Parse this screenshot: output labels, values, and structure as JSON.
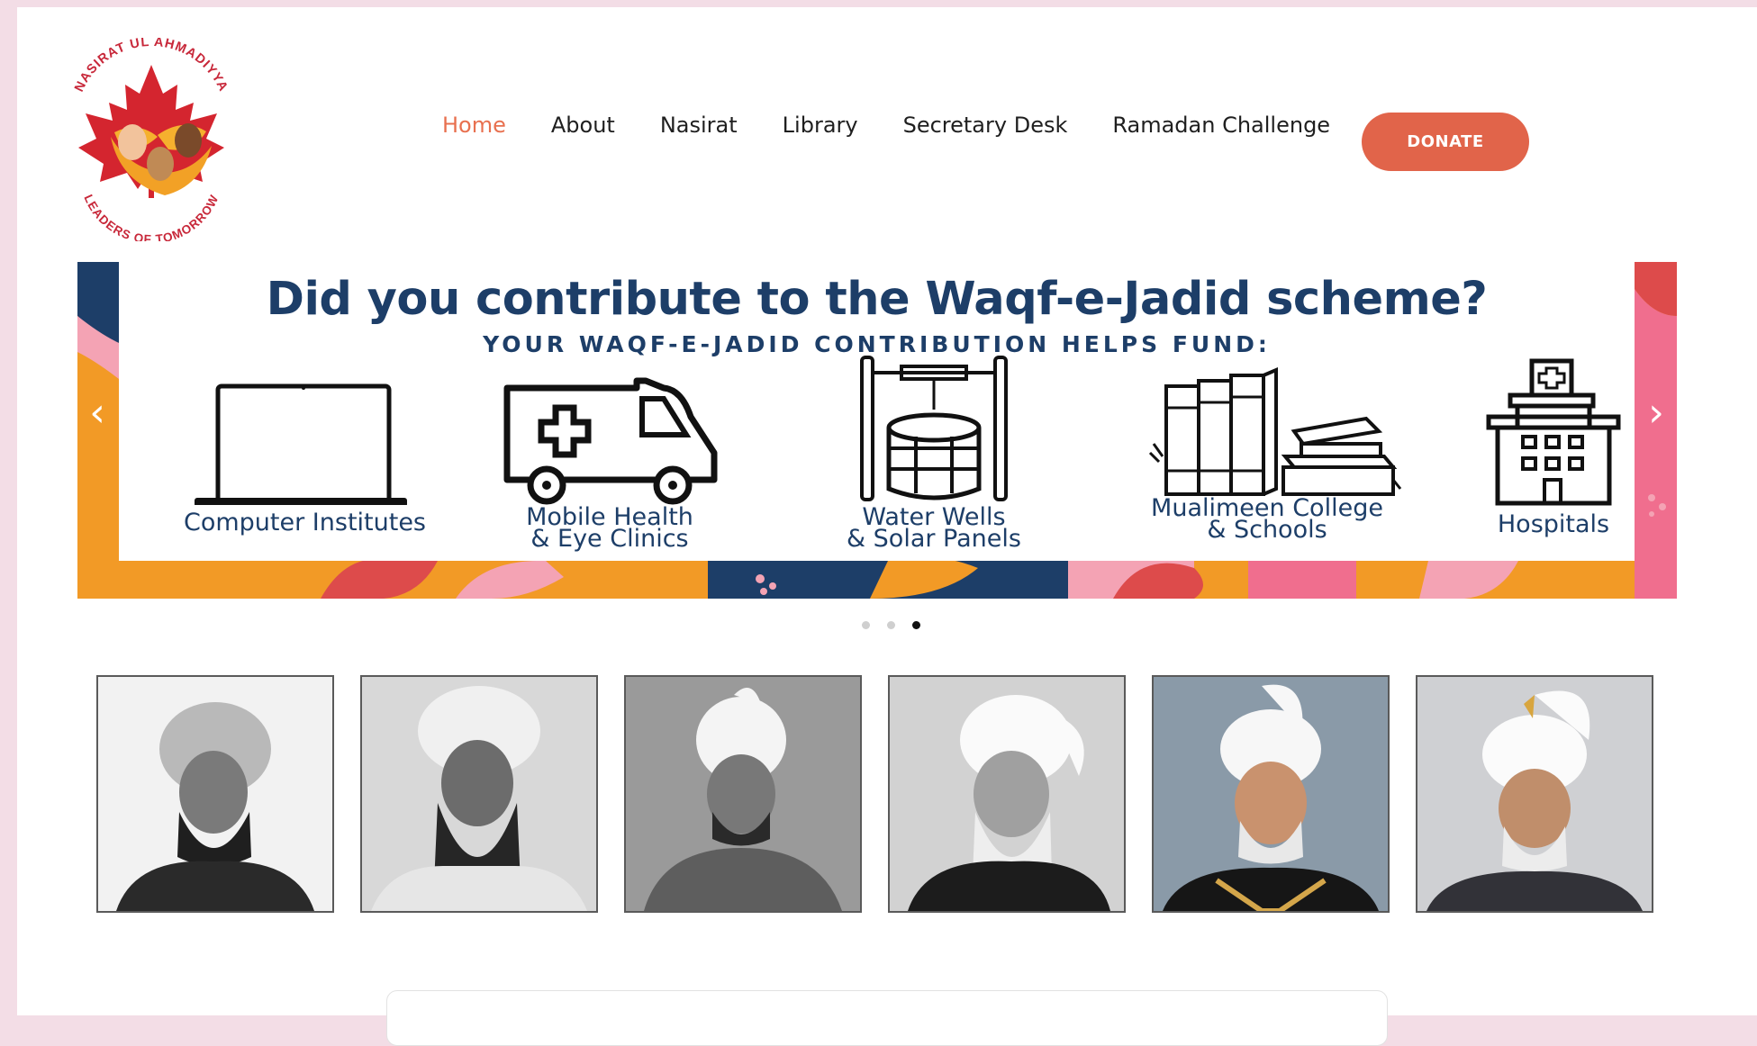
{
  "header": {
    "logo": {
      "top_text": "NASIRAT UL AHMADIYYA",
      "bottom_text": "LEADERS OF TOMORROW",
      "colors": {
        "red": "#c8283a",
        "orange": "#f0a32c"
      }
    },
    "nav": [
      {
        "label": "Home",
        "active": true
      },
      {
        "label": "About",
        "active": false
      },
      {
        "label": "Nasirat",
        "active": false
      },
      {
        "label": "Library",
        "active": false
      },
      {
        "label": "Secretary Desk",
        "active": false
      },
      {
        "label": "Ramadan Challenge",
        "active": false
      }
    ],
    "donate_label": "DONATE",
    "accent_color": "#e8704f"
  },
  "banner": {
    "title": "Did you contribute to the Waqf-e-Jadid scheme?",
    "subtitle": "YOUR WAQF-E-JADID CONTRIBUTION HELPS FUND:",
    "items": [
      {
        "icon": "laptop-icon",
        "line1": "Computer Institutes",
        "line2": ""
      },
      {
        "icon": "ambulance-icon",
        "line1": "Mobile Health",
        "line2": "& Eye Clinics"
      },
      {
        "icon": "water-well-icon",
        "line1": "Water Wells",
        "line2": "& Solar Panels"
      },
      {
        "icon": "books-icon",
        "line1": "Mualimeen College",
        "line2": "& Schools"
      },
      {
        "icon": "hospital-icon",
        "line1": "Hospitals",
        "line2": ""
      }
    ],
    "colors": {
      "navy": "#1d3e68",
      "orange": "#f29a26",
      "pink": "#f4a3b4",
      "red": "#dd4b4b"
    },
    "prev_icon": "chevron-left-icon",
    "next_icon": "chevron-right-icon",
    "slides": 3,
    "active_slide": 3
  },
  "portraits": [
    {
      "style": "bw"
    },
    {
      "style": "bw"
    },
    {
      "style": "bw"
    },
    {
      "style": "bw"
    },
    {
      "style": "color"
    },
    {
      "style": "color"
    }
  ]
}
